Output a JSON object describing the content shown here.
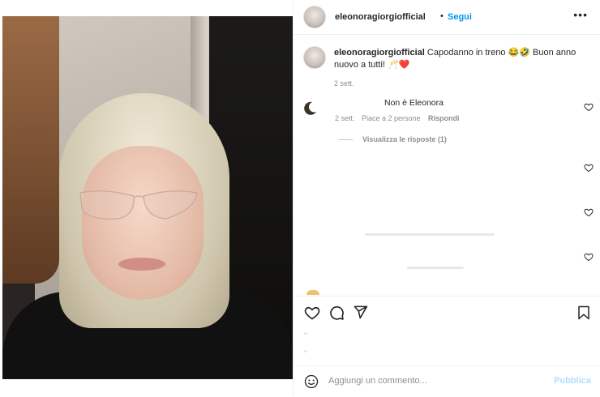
{
  "post": {
    "username": "eleonoragiorgiofficial",
    "separator": "•",
    "follow_label": "Segui",
    "more_label": "•••"
  },
  "caption": {
    "username": "eleonoragiorgiofficial",
    "text": "Capodanno in treno 😂🤣 Buon anno nuovo a tutti! 🥂❤️",
    "time": "2 sett."
  },
  "comments": [
    {
      "text": "Non è Eleonora",
      "time": "2 sett.",
      "likes": "Piace a 2 persone",
      "reply_label": "Rispondi",
      "view_replies": "Visualizza le risposte (1)"
    }
  ],
  "add_comment": {
    "placeholder": "Aggiungi un commento...",
    "publish_label": "Pubblica"
  },
  "colors": {
    "accent": "#0095f6",
    "publish_disabled": "#b2dffc",
    "muted": "#8e8e8e",
    "text": "#262626"
  },
  "icons": [
    "heart-icon",
    "comment-icon",
    "share-icon",
    "bookmark-icon",
    "emoji-icon",
    "more-icon"
  ]
}
